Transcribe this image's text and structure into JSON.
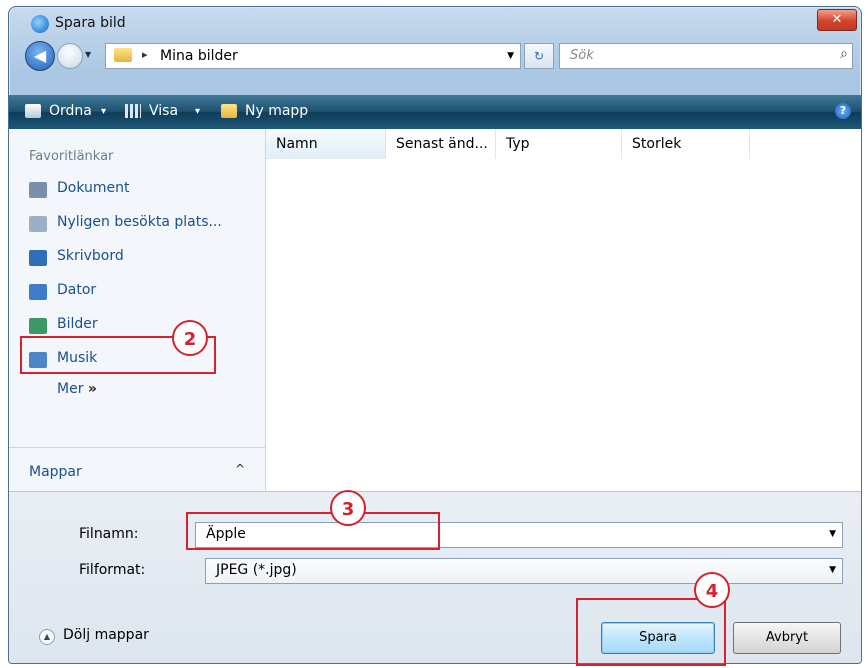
{
  "window": {
    "title": "Spara bild",
    "close_glyph": "✕"
  },
  "nav": {
    "breadcrumb_sep": "▸",
    "breadcrumb": "Mina bilder",
    "search_placeholder": "Sök",
    "refresh_glyph": "↻"
  },
  "toolbar": {
    "organize_label": "Ordna",
    "view_label": "Visa",
    "new_folder_label": "Ny mapp",
    "dropdown_glyph": "▾",
    "help_glyph": "?"
  },
  "sidebar": {
    "heading": "Favoritlänkar",
    "items": [
      {
        "label": "Dokument",
        "icon": "documents-icon",
        "color": "#7a8fa8"
      },
      {
        "label": "Nyligen besökta plats...",
        "icon": "recent-places-icon",
        "color": "#9bb0c6"
      },
      {
        "label": "Skrivbord",
        "icon": "desktop-icon",
        "color": "#2f6fb8"
      },
      {
        "label": "Dator",
        "icon": "computer-icon",
        "color": "#3d7cc9"
      },
      {
        "label": "Bilder",
        "icon": "pictures-icon",
        "color": "#3a9a66"
      },
      {
        "label": "Musik",
        "icon": "music-icon",
        "color": "#4a86c8"
      }
    ],
    "more_label": "Mer",
    "more_glyph": "»",
    "folders_label": "Mappar",
    "folders_caret": "^"
  },
  "filelist": {
    "columns": [
      "Namn",
      "Senast änd...",
      "Typ",
      "Storlek"
    ]
  },
  "form": {
    "filename_label": "Filnamn:",
    "filename_value": "Äpple",
    "format_label": "Filformat:",
    "format_value": "JPEG (*.jpg)",
    "hide_folders_label": "Dölj mappar",
    "save_label": "Spara",
    "cancel_label": "Avbryt"
  },
  "callouts": [
    "2",
    "3",
    "4"
  ],
  "colors": {
    "callout": "#d4232e",
    "toolbar": "#1e5270",
    "link": "#1a4f91"
  }
}
